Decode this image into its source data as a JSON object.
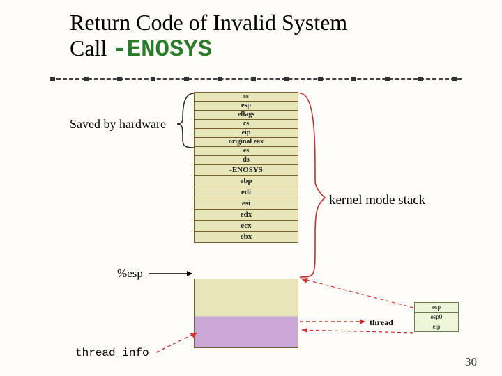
{
  "title_line1": "Return Code of Invalid System",
  "title_line2a": "Call ",
  "title_line2b": "-ENOSYS",
  "saved_label": "Saved by hardware",
  "kernel_label": "kernel mode stack",
  "esp_label": "%esp",
  "thread_label": "thread",
  "thread_info_label": "thread_info",
  "page_number": "30",
  "stack": [
    "ss",
    "esp",
    "eflags",
    "cs",
    "eip",
    "original eax",
    "es",
    "ds",
    "-ENOSYS",
    "ebp",
    "edi",
    "esi",
    "edx",
    "ecx",
    "ebx"
  ],
  "thread_struct": [
    "esp",
    "esp0",
    "eip"
  ]
}
